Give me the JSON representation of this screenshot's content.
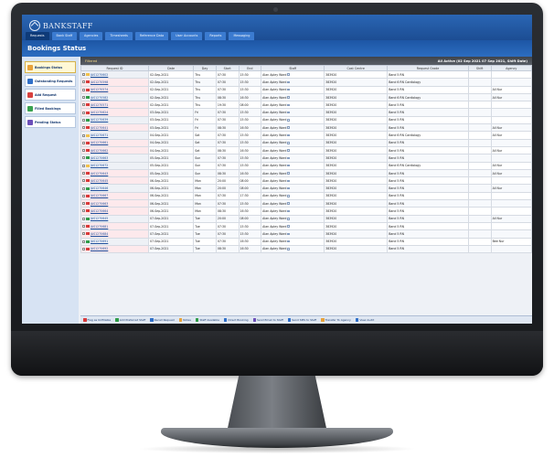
{
  "app": {
    "brand": "BANKSTAFF"
  },
  "nav": [
    {
      "label": "Requests",
      "active": true
    },
    {
      "label": "Bank Staff",
      "active": false
    },
    {
      "label": "Agencies",
      "active": false
    },
    {
      "label": "Timesheets",
      "active": false
    },
    {
      "label": "Reference Data",
      "active": false
    },
    {
      "label": "User Accounts",
      "active": false
    },
    {
      "label": "Reports",
      "active": false
    },
    {
      "label": "Messaging",
      "active": false
    }
  ],
  "page_title": "Bookings Status",
  "sidebar": [
    {
      "label": "Bookings Status",
      "color": "#e8a23a",
      "active": true
    },
    {
      "label": "Outstanding Requests",
      "color": "#2f6fc8",
      "active": false
    },
    {
      "label": "Add Request",
      "color": "#d8413f",
      "active": false
    },
    {
      "label": "Filled Bookings",
      "color": "#39a24f",
      "active": false
    },
    {
      "label": "Pending Status",
      "color": "#6c4fb8",
      "active": false
    }
  ],
  "table_header": {
    "filter": "Filtered",
    "period": "All Active (02 Sep 2021 07 Sep 2021, Shift Date)"
  },
  "columns": [
    "Request ID",
    "Date",
    "Day",
    "Start",
    "End",
    "Staff",
    "Cost Centre",
    "Request Grade",
    "Shift",
    "Agency"
  ],
  "rows": [
    {
      "flag": "#f2c14b",
      "id": "JAS1270602",
      "date": "02-Sep-2021",
      "day": "Thu",
      "start": "07:30",
      "end": "15:30",
      "staff": "Alan Apley Ward",
      "cc": "383920",
      "grade": "Band 5 RN",
      "shift": "",
      "agency": "",
      "pink": false
    },
    {
      "flag": "#d93a3a",
      "id": "JAS1270598",
      "date": "02-Sep-2021",
      "day": "Thu",
      "start": "07:30",
      "end": "15:30",
      "staff": "Alan Apley Ward",
      "cc": "383920",
      "grade": "Band 6 RN Cardiology",
      "shift": "",
      "agency": "",
      "pink": true
    },
    {
      "flag": "#d93a3a",
      "id": "JAS1270574",
      "date": "02-Sep-2021",
      "day": "Thu",
      "start": "07:30",
      "end": "15:30",
      "staff": "Alan Apley Ward",
      "cc": "383920",
      "grade": "Band 5 RN",
      "shift": "",
      "agency": "All Nur",
      "pink": true
    },
    {
      "flag": "#2e9c48",
      "id": "JAS1270582",
      "date": "02-Sep-2021",
      "day": "Thu",
      "start": "08:30",
      "end": "16:30",
      "staff": "Alan Apley Ward",
      "cc": "383920",
      "grade": "Band 6 RN Cardiology",
      "shift": "",
      "agency": "All Nur",
      "pink": false
    },
    {
      "flag": "#d93a3a",
      "id": "JAS1270571",
      "date": "02-Sep-2021",
      "day": "Thu",
      "start": "19:30",
      "end": "08:00",
      "staff": "Alan Apley Ward",
      "cc": "383920",
      "grade": "Band 5 RN",
      "shift": "",
      "agency": "",
      "pink": true
    },
    {
      "flag": "#d93a3a",
      "id": "JAS1270624",
      "date": "03-Sep-2021",
      "day": "Fri",
      "start": "07:30",
      "end": "15:30",
      "staff": "Alan Apley Ward",
      "cc": "383920",
      "grade": "Band 5 RN",
      "shift": "",
      "agency": "",
      "pink": true
    },
    {
      "flag": "#2e9c48",
      "id": "JAS1270639",
      "date": "03-Sep-2021",
      "day": "Fri",
      "start": "07:30",
      "end": "15:30",
      "staff": "Alan Apley Ward",
      "cc": "383920",
      "grade": "Band 5 RN",
      "shift": "",
      "agency": "",
      "pink": false
    },
    {
      "flag": "#d93a3a",
      "id": "JAS1270641",
      "date": "03-Sep-2021",
      "day": "Fri",
      "start": "08:30",
      "end": "16:30",
      "staff": "Alan Apley Ward",
      "cc": "383920",
      "grade": "Band 5 RN",
      "shift": "",
      "agency": "All Nur",
      "pink": true
    },
    {
      "flag": "#f2c14b",
      "id": "JAS1270671",
      "date": "04-Sep-2021",
      "day": "Sat",
      "start": "07:30",
      "end": "15:30",
      "staff": "Alan Apley Ward",
      "cc": "383920",
      "grade": "Band 6 RN Cardiology",
      "shift": "",
      "agency": "All Nur",
      "pink": false
    },
    {
      "flag": "#d93a3a",
      "id": "JAS1270661",
      "date": "04-Sep-2021",
      "day": "Sat",
      "start": "07:30",
      "end": "15:30",
      "staff": "Alan Apley Ward",
      "cc": "383920",
      "grade": "Band 5 RN",
      "shift": "",
      "agency": "",
      "pink": true
    },
    {
      "flag": "#d93a3a",
      "id": "JAS1270662",
      "date": "04-Sep-2021",
      "day": "Sat",
      "start": "08:30",
      "end": "16:30",
      "staff": "Alan Apley Ward",
      "cc": "383920",
      "grade": "Band 5 RN",
      "shift": "",
      "agency": "All Nur",
      "pink": true
    },
    {
      "flag": "#2e9c48",
      "id": "JAS1270663",
      "date": "05-Sep-2021",
      "day": "Sun",
      "start": "07:30",
      "end": "15:30",
      "staff": "Alan Apley Ward",
      "cc": "383920",
      "grade": "Band 5 RN",
      "shift": "",
      "agency": "",
      "pink": false
    },
    {
      "flag": "#f2c14b",
      "id": "JAS1270672",
      "date": "05-Sep-2021",
      "day": "Sun",
      "start": "07:30",
      "end": "15:30",
      "staff": "Alan Apley Ward",
      "cc": "383920",
      "grade": "Band 6 RN Cardiology",
      "shift": "",
      "agency": "All Nur",
      "pink": false
    },
    {
      "flag": "#d93a3a",
      "id": "JAS1270643",
      "date": "05-Sep-2021",
      "day": "Sun",
      "start": "08:30",
      "end": "16:30",
      "staff": "Alan Apley Ward",
      "cc": "383920",
      "grade": "Band 5 RN",
      "shift": "",
      "agency": "All Nur",
      "pink": true
    },
    {
      "flag": "#d93a3a",
      "id": "JAS1270645",
      "date": "06-Sep-2021",
      "day": "Mon",
      "start": "20:00",
      "end": "08:00",
      "staff": "Alan Apley Ward",
      "cc": "383920",
      "grade": "Band 5 RN",
      "shift": "",
      "agency": "",
      "pink": true
    },
    {
      "flag": "#2e9c48",
      "id": "JAS1270646",
      "date": "06-Sep-2021",
      "day": "Mon",
      "start": "20:00",
      "end": "08:00",
      "staff": "Alan Apley Ward",
      "cc": "383920",
      "grade": "Band 5 RN",
      "shift": "",
      "agency": "All Nur",
      "pink": false
    },
    {
      "flag": "#d93a3a",
      "id": "JAS1270667",
      "date": "06-Sep-2021",
      "day": "Mon",
      "start": "07:30",
      "end": "17:30",
      "staff": "Alan Apley Ward",
      "cc": "383920",
      "grade": "Band 5 RN",
      "shift": "",
      "agency": "",
      "pink": true
    },
    {
      "flag": "#d93a3a",
      "id": "JAS1270663",
      "date": "06-Sep-2021",
      "day": "Mon",
      "start": "07:30",
      "end": "15:30",
      "staff": "Alan Apley Ward",
      "cc": "383920",
      "grade": "Band 5 RN",
      "shift": "",
      "agency": "",
      "pink": true
    },
    {
      "flag": "#d93a3a",
      "id": "JAS1270664",
      "date": "06-Sep-2021",
      "day": "Mon",
      "start": "08:30",
      "end": "16:30",
      "staff": "Alan Apley Ward",
      "cc": "383920",
      "grade": "Band 5 RN",
      "shift": "",
      "agency": "",
      "pink": true
    },
    {
      "flag": "#2e9c48",
      "id": "JAS1270645",
      "date": "07-Sep-2021",
      "day": "Tue",
      "start": "20:00",
      "end": "08:00",
      "staff": "Alan Apley Ward",
      "cc": "383920",
      "grade": "Band 5 RN",
      "shift": "",
      "agency": "All Nur",
      "pink": false
    },
    {
      "flag": "#d93a3a",
      "id": "JAS1270681",
      "date": "07-Sep-2021",
      "day": "Tue",
      "start": "07:30",
      "end": "15:30",
      "staff": "Alan Apley Ward",
      "cc": "383920",
      "grade": "Band 5 RN",
      "shift": "",
      "agency": "",
      "pink": true
    },
    {
      "flag": "#d93a3a",
      "id": "JAS1270684",
      "date": "07-Sep-2021",
      "day": "Tue",
      "start": "07:30",
      "end": "15:30",
      "staff": "Alan Apley Ward",
      "cc": "383920",
      "grade": "Band 5 RN",
      "shift": "",
      "agency": "",
      "pink": true
    },
    {
      "flag": "#2e9c48",
      "id": "JAS1270691",
      "date": "07-Sep-2021",
      "day": "Tue",
      "start": "07:30",
      "end": "16:30",
      "staff": "Alan Apley Ward",
      "cc": "383920",
      "grade": "Band 5 RN",
      "shift": "",
      "agency": "Bee Nur",
      "pink": false
    },
    {
      "flag": "#d93a3a",
      "id": "JAS1270692",
      "date": "07-Sep-2021",
      "day": "Tue",
      "start": "08:30",
      "end": "16:30",
      "staff": "Alan Apley Ward",
      "cc": "383920",
      "grade": "Band 5 RN",
      "shift": "",
      "agency": "",
      "pink": true
    }
  ],
  "footer_actions": [
    {
      "label": "Flag as Unfillable",
      "color": "#d93a3a"
    },
    {
      "label": "Add Preferred Staff",
      "color": "#2e9c48"
    },
    {
      "label": "Recall Request",
      "color": "#2f6fc8"
    },
    {
      "label": "Notes",
      "color": "#e8a23a"
    },
    {
      "label": "Staff Available",
      "color": "#2e9c48"
    },
    {
      "label": "Direct Booking",
      "color": "#2f6fc8"
    },
    {
      "label": "Send Email to Staff",
      "color": "#6c4fb8"
    },
    {
      "label": "Send SMS to Staff",
      "color": "#2f6fc8"
    },
    {
      "label": "Transfer To Agency",
      "color": "#e8a23a"
    },
    {
      "label": "View Audit",
      "color": "#2f6fc8"
    }
  ]
}
